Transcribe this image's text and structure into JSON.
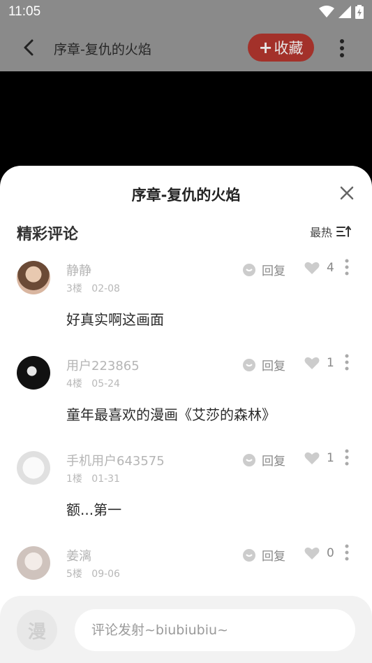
{
  "status": {
    "time": "11:05"
  },
  "header": {
    "title": "序章-复仇的火焰",
    "collect_label": "收藏",
    "collect_plus": "+"
  },
  "sheet": {
    "title": "序章-复仇的火焰",
    "section_title": "精彩评论",
    "sort_label": "最热"
  },
  "comments": [
    {
      "user": "静静",
      "floor": "3楼",
      "date": "02-08",
      "reply": "回复",
      "likes": "4",
      "text": "好真实啊这画面"
    },
    {
      "user": "用户223865",
      "floor": "4楼",
      "date": "05-24",
      "reply": "回复",
      "likes": "1",
      "text": "童年最喜欢的漫画《艾莎的森林》"
    },
    {
      "user": "手机用户643575",
      "floor": "1楼",
      "date": "01-31",
      "reply": "回复",
      "likes": "1",
      "text": "额...第一"
    },
    {
      "user": "姜漓",
      "floor": "5楼",
      "date": "09-06",
      "reply": "回复",
      "likes": "0",
      "text": ""
    }
  ],
  "bottom": {
    "manga_char": "漫",
    "input_placeholder": "评论发射~biubiubiu~"
  }
}
